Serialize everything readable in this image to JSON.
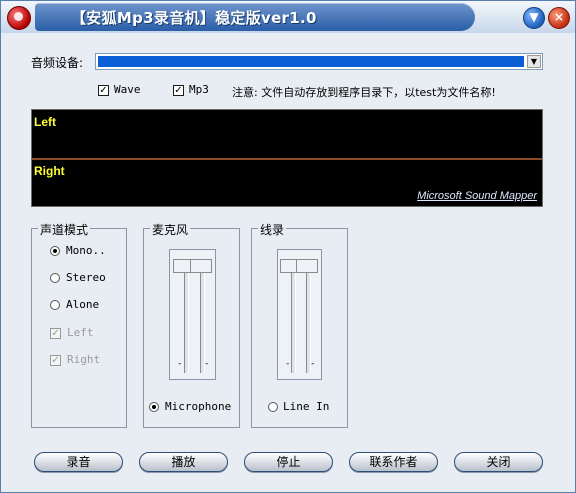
{
  "window": {
    "title": "【安狐Mp3录音机】稳定版ver1.0",
    "minimize_glyph": "▼",
    "close_glyph": "×"
  },
  "device": {
    "label": "音频设备:",
    "arrow_glyph": "▼"
  },
  "formats": {
    "wave_label": "Wave",
    "wave_checked": true,
    "mp3_label": "Mp3",
    "mp3_checked": true,
    "check_glyph": "✓"
  },
  "notice": "注意: 文件自动存放到程序目录下，以test为文件名称!",
  "meter": {
    "left_label": "Left",
    "right_label": "Right",
    "mapper_label": "Microsoft Sound Mapper"
  },
  "channel_mode": {
    "title": "声道模式",
    "options": [
      {
        "label": "Mono..",
        "selected": true,
        "enabled": true
      },
      {
        "label": "Stereo",
        "selected": false,
        "enabled": true
      },
      {
        "label": "Alone",
        "selected": false,
        "enabled": true
      }
    ],
    "checks": [
      {
        "label": "Left",
        "checked": true,
        "enabled": false
      },
      {
        "label": "Right",
        "checked": true,
        "enabled": false
      }
    ]
  },
  "mic": {
    "title": "麦克风",
    "radio_label": "Microphone",
    "selected": true
  },
  "line": {
    "title": "线录",
    "radio_label": "Line In",
    "selected": false
  },
  "slider_marks": {
    "dash": "-"
  },
  "buttons": {
    "record": "录音",
    "play": "播放",
    "stop": "停止",
    "contact": "联系作者",
    "close": "关闭"
  }
}
